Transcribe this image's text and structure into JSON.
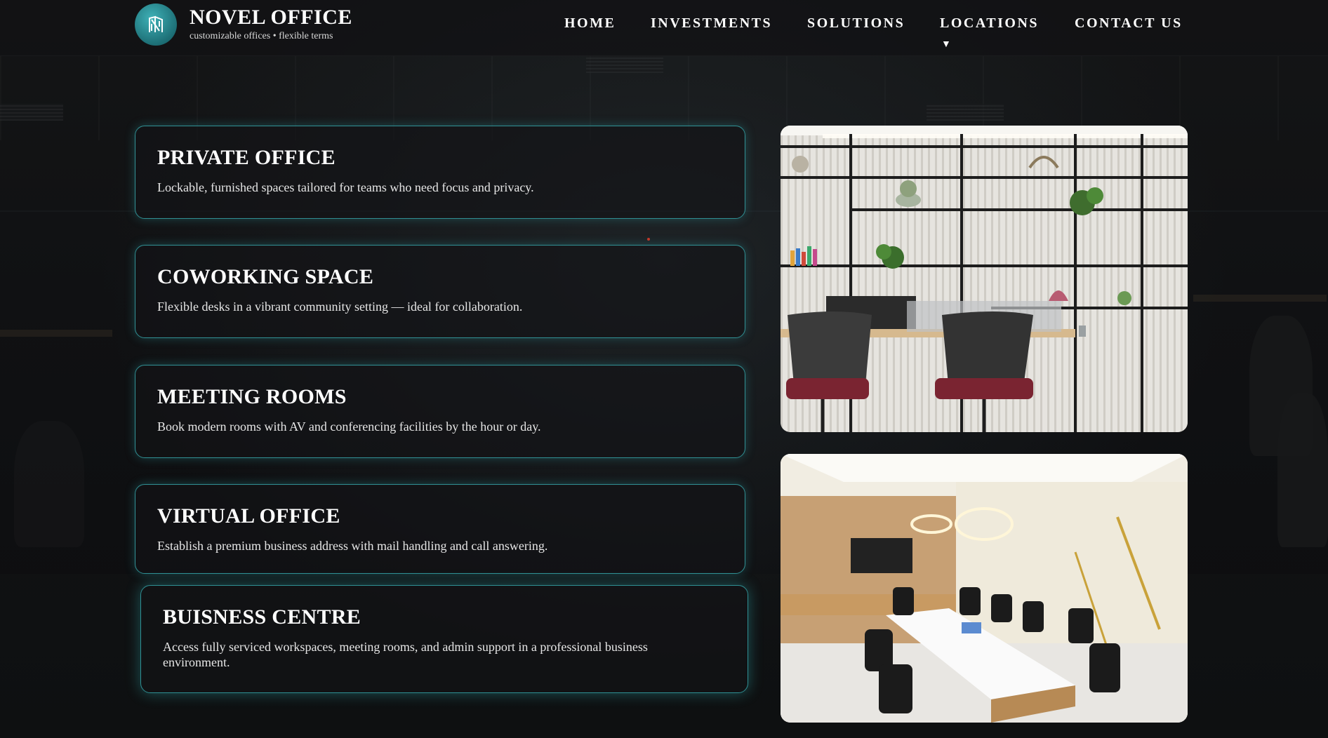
{
  "brand": {
    "title": "NOVEL OFFICE",
    "subtitle": "customizable offices • flexible terms",
    "logo_icon": "building-logo-icon",
    "accent": "#2f8f93"
  },
  "nav": {
    "items": [
      {
        "label": "HOME"
      },
      {
        "label": "INVESTMENTS"
      },
      {
        "label": "SOLUTIONS"
      },
      {
        "label": "LOCATIONS",
        "has_dropdown": true
      },
      {
        "label": "CONTACT US"
      }
    ],
    "dropdown_glyph": "▼"
  },
  "cards": [
    {
      "title": "PRIVATE OFFICE",
      "desc": "Lockable, furnished spaces tailored for teams who need focus and privacy."
    },
    {
      "title": "COWORKING SPACE",
      "desc": "Flexible desks in a vibrant community setting — ideal for collaboration."
    },
    {
      "title": "MEETING ROOMS",
      "desc": "Book modern rooms with AV and conferencing facilities by the hour or day."
    },
    {
      "title": "VIRTUAL OFFICE",
      "desc": "Establish a premium business address with mail handling and call answering."
    },
    {
      "title": "BUISNESS CENTRE",
      "desc": "Access fully serviced workspaces, meeting rooms, and admin support in a professional business environment."
    }
  ],
  "images": [
    {
      "name": "office-desk-shelves-photo"
    },
    {
      "name": "conference-room-photo"
    }
  ]
}
